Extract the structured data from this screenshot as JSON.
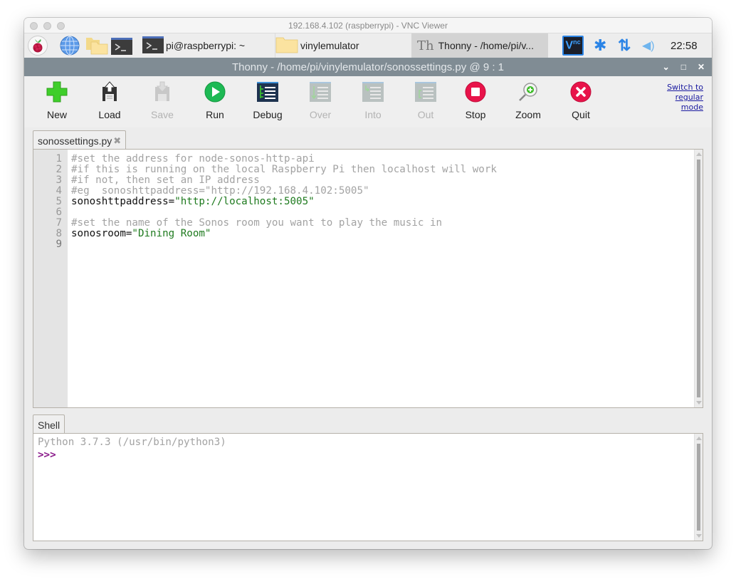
{
  "vnc": {
    "title": "192.168.4.102 (raspberrypi) - VNC Viewer"
  },
  "panel": {
    "launchers": [
      {
        "name": "raspberry-menu",
        "icon": "raspberry-pi-icon"
      },
      {
        "name": "web-browser",
        "icon": "globe-icon"
      },
      {
        "name": "file-manager",
        "icon": "folder-icon"
      },
      {
        "name": "terminal",
        "icon": "terminal-icon"
      }
    ],
    "tasks": [
      {
        "label": "pi@raspberrypi: ~",
        "icon": "terminal-icon"
      },
      {
        "label": "vinylemulator",
        "icon": "folder-icon"
      },
      {
        "label": "Thonny  -  /home/pi/v...",
        "icon": "thonny-icon",
        "active": true
      }
    ],
    "tray": {
      "vnc_icon_text": "V",
      "vnc_icon_sub": "nc",
      "bluetooth_glyph": "✱",
      "network_glyph": "⇅",
      "volume_glyph": "◀)",
      "clock": "22:58"
    }
  },
  "thonny": {
    "title": "Thonny  -  /home/pi/vinylemulator/sonossettings.py  @  9 : 1",
    "window_controls": {
      "minimize": "⌄",
      "maximize": "□",
      "close": "✕"
    },
    "toolbar": [
      {
        "id": "new",
        "label": "New",
        "icon": "new-file-icon",
        "enabled": true
      },
      {
        "id": "load",
        "label": "Load",
        "icon": "load-icon",
        "enabled": true
      },
      {
        "id": "save",
        "label": "Save",
        "icon": "save-icon",
        "enabled": false
      },
      {
        "id": "run",
        "label": "Run",
        "icon": "run-icon",
        "enabled": true
      },
      {
        "id": "debug",
        "label": "Debug",
        "icon": "debug-icon",
        "enabled": true
      },
      {
        "id": "over",
        "label": "Over",
        "icon": "step-over-icon",
        "enabled": false
      },
      {
        "id": "into",
        "label": "Into",
        "icon": "step-into-icon",
        "enabled": false
      },
      {
        "id": "out",
        "label": "Out",
        "icon": "step-out-icon",
        "enabled": false
      },
      {
        "id": "stop",
        "label": "Stop",
        "icon": "stop-icon",
        "enabled": true
      },
      {
        "id": "zoom",
        "label": "Zoom",
        "icon": "zoom-icon",
        "enabled": true
      },
      {
        "id": "quit",
        "label": "Quit",
        "icon": "quit-icon",
        "enabled": true
      }
    ],
    "switch_mode": {
      "line1": "Switch to",
      "line2": "regular",
      "line3": "mode"
    },
    "editor": {
      "tab_label": "sonossettings.py",
      "tab_close": "✖",
      "current_line": 9,
      "line_numbers": [
        "1",
        "2",
        "3",
        "4",
        "5",
        "6",
        "7",
        "8",
        "9"
      ],
      "lines": [
        [
          {
            "t": "comment",
            "v": "#set the address for node-sonos-http-api"
          }
        ],
        [
          {
            "t": "comment",
            "v": "#if this is running on the local Raspberry Pi then localhost will work"
          }
        ],
        [
          {
            "t": "comment",
            "v": "#if not, then set an IP address"
          }
        ],
        [
          {
            "t": "comment",
            "v": "#eg  sonoshttpaddress=\"http://192.168.4.102:5005\""
          }
        ],
        [
          {
            "t": "ident",
            "v": "sonoshttpaddress="
          },
          {
            "t": "string",
            "v": "\"http://localhost:5005\""
          }
        ],
        [
          {
            "t": "ident",
            "v": ""
          }
        ],
        [
          {
            "t": "comment",
            "v": "#set the name of the Sonos room you want to play the music in"
          }
        ],
        [
          {
            "t": "ident",
            "v": "sonosroom="
          },
          {
            "t": "string",
            "v": "\"Dining Room\""
          }
        ],
        [
          {
            "t": "ident",
            "v": ""
          }
        ]
      ]
    },
    "shell": {
      "tab_label": "Shell",
      "banner": "Python 3.7.3 (/usr/bin/python3)",
      "prompt": ">>>"
    }
  }
}
